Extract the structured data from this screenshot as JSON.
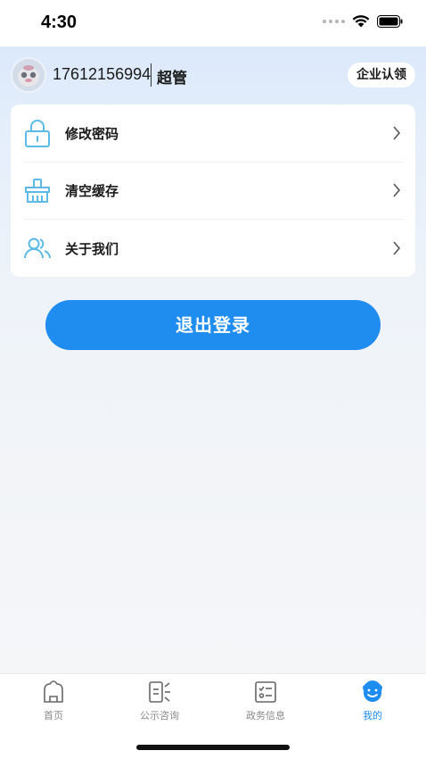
{
  "status_bar": {
    "time": "4:30"
  },
  "profile": {
    "phone": "17612156994",
    "role": "超管",
    "cert_button": "企业认领"
  },
  "menu": {
    "items": [
      {
        "label": "修改密码",
        "icon": "lock-icon"
      },
      {
        "label": "清空缓存",
        "icon": "broom-icon"
      },
      {
        "label": "关于我们",
        "icon": "users-icon"
      }
    ]
  },
  "logout_label": "退出登录",
  "tab_bar": {
    "tabs": [
      {
        "label": "首页",
        "icon": "home-icon",
        "active": false
      },
      {
        "label": "公示咨询",
        "icon": "notice-icon",
        "active": false
      },
      {
        "label": "政务信息",
        "icon": "checklist-icon",
        "active": false
      },
      {
        "label": "我的",
        "icon": "profile-icon",
        "active": true
      }
    ]
  },
  "colors": {
    "accent": "#1f8cf0",
    "icon_line": "#5bbbe6",
    "inactive": "#8a8a8a"
  }
}
